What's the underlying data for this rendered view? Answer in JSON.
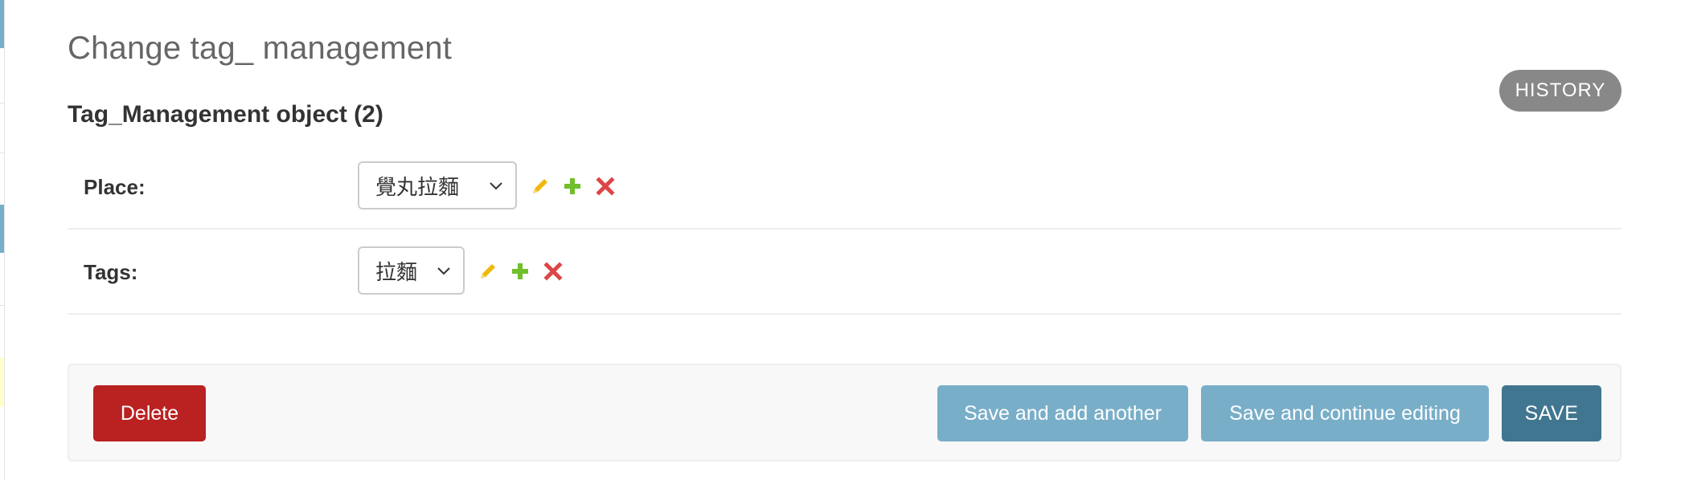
{
  "page": {
    "title": "Change tag_ management",
    "object_title": "Tag_Management object (2)"
  },
  "object_tools": {
    "history_label": "History"
  },
  "fields": [
    {
      "label": "Place:",
      "selected_value": "覺丸拉麵",
      "icons": [
        "pencil-icon",
        "plus-icon",
        "x-icon"
      ]
    },
    {
      "label": "Tags:",
      "selected_value": "拉麵",
      "icons": [
        "pencil-icon",
        "plus-icon",
        "x-icon"
      ]
    }
  ],
  "submit_row": {
    "delete_label": "Delete",
    "save_add_another_label": "Save and add another",
    "save_continue_label": "Save and continue editing",
    "save_label": "Save"
  },
  "colors": {
    "delete": "#ba2121",
    "secondary_save": "#79aec8",
    "primary_save": "#417690",
    "history": "#888888",
    "edit_icon": "#efb80b",
    "add_icon": "#70bf2b",
    "delete_icon": "#dd4646"
  }
}
